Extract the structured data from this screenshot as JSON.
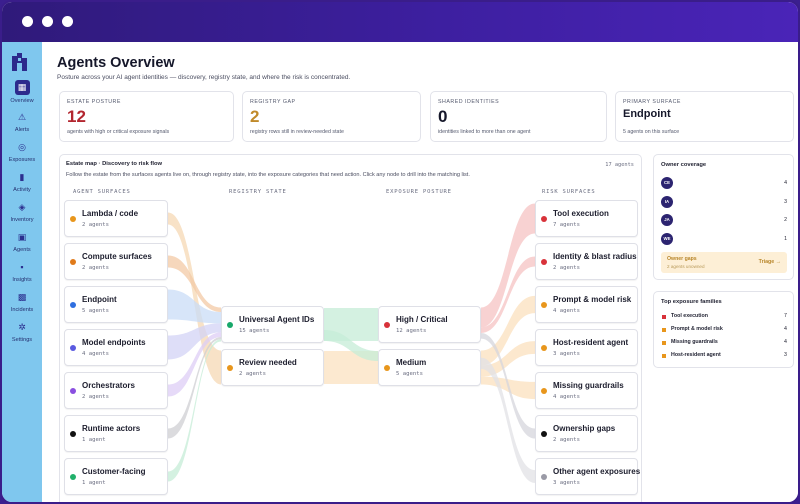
{
  "window": {
    "controls": [
      "close",
      "minimize",
      "maximize"
    ]
  },
  "sidebar": {
    "logo": "brand-logo",
    "items": [
      {
        "id": "overview",
        "label": "Overview",
        "icon": "grid-icon",
        "active": true
      },
      {
        "id": "alerts",
        "label": "Alerts",
        "icon": "warning-triangle-icon"
      },
      {
        "id": "exposures",
        "label": "Exposures",
        "icon": "target-icon"
      },
      {
        "id": "activity",
        "label": "Activity",
        "icon": "bar-chart-icon"
      },
      {
        "id": "inventory",
        "label": "Inventory",
        "icon": "layers-icon"
      },
      {
        "id": "agents",
        "label": "Agents",
        "icon": "robot-icon"
      },
      {
        "id": "insights",
        "label": "Insights",
        "icon": "lightbulb-icon"
      },
      {
        "id": "incidents",
        "label": "Incidents",
        "icon": "incident-grid-icon"
      },
      {
        "id": "settings",
        "label": "Settings",
        "icon": "gear-icon"
      }
    ]
  },
  "page": {
    "title": "Agents Overview",
    "subtitle": "Posture across your AI agent identities — discovery, registry state, and where the risk is concentrated."
  },
  "kpis": [
    {
      "label": "ESTATE POSTURE",
      "value": "12",
      "note": "agents with high or critical exposure signals",
      "color": "#b3262f"
    },
    {
      "label": "REGISTRY GAP",
      "value": "2",
      "note": "registry rows still in review-needed state",
      "color": "#c08a2a"
    },
    {
      "label": "SHARED IDENTITIES",
      "value": "0",
      "note": "identities linked to more than one agent",
      "color": "#15172a"
    },
    {
      "label": "PRIMARY SURFACE",
      "value": "Endpoint",
      "note": "5 agents on this surface",
      "color": "#15172a"
    }
  ],
  "estate_map": {
    "title": "Estate map · Discovery to risk flow",
    "count": "17 agents",
    "description": "Follow the estate from the surfaces agents live on, through registry state, into the exposure categories that need action. Click any node to drill into the matching list.",
    "columns": [
      "AGENT SURFACES",
      "REGISTRY STATE",
      "EXPOSURE POSTURE",
      "RISK SURFACES"
    ],
    "surfaces": [
      {
        "name": "Lambda / code",
        "sub": "2 agents",
        "count": 2,
        "color": "#e8961c"
      },
      {
        "name": "Compute surfaces",
        "sub": "2 agents",
        "count": 2,
        "color": "#e07a1a"
      },
      {
        "name": "Endpoint",
        "sub": "5 agents",
        "count": 5,
        "color": "#2f6fe0"
      },
      {
        "name": "Model endpoints",
        "sub": "4 agents",
        "count": 4,
        "color": "#5a5ae0"
      },
      {
        "name": "Orchestrators",
        "sub": "2 agents",
        "count": 2,
        "color": "#8a4fe0"
      },
      {
        "name": "Runtime actors",
        "sub": "1 agent",
        "count": 1,
        "color": "#111111"
      },
      {
        "name": "Customer-facing",
        "sub": "1 agent",
        "count": 1,
        "color": "#20b06a"
      }
    ],
    "registry": [
      {
        "name": "Universal Agent IDs",
        "sub": "15 agents",
        "count": 15,
        "color": "#18a86a"
      },
      {
        "name": "Review needed",
        "sub": "2 agents",
        "count": 2,
        "color": "#e8961c"
      }
    ],
    "exposure": [
      {
        "name": "High / Critical",
        "sub": "12 agents",
        "count": 12,
        "color": "#d8323a"
      },
      {
        "name": "Medium",
        "sub": "5 agents",
        "count": 5,
        "color": "#e8961c"
      }
    ],
    "risks": [
      {
        "name": "Tool execution",
        "sub": "7 agents",
        "count": 7,
        "color": "#d8323a"
      },
      {
        "name": "Identity & blast radius",
        "sub": "2 agents",
        "count": 2,
        "color": "#d8323a"
      },
      {
        "name": "Prompt & model risk",
        "sub": "4 agents",
        "count": 4,
        "color": "#e8961c"
      },
      {
        "name": "Host-resident agent",
        "sub": "3 agents",
        "count": 3,
        "color": "#e8961c"
      },
      {
        "name": "Missing guardrails",
        "sub": "4 agents",
        "count": 4,
        "color": "#e8961c"
      },
      {
        "name": "Ownership gaps",
        "sub": "2 agents",
        "count": 2,
        "color": "#111111"
      },
      {
        "name": "Other agent exposures",
        "sub": "3 agents",
        "count": 3,
        "color": "#9a9aa6"
      }
    ],
    "link_colors": {
      "surface": [
        "#f6d8b4",
        "#f3c9a6",
        "#c9dcf7",
        "#d3d3f6",
        "#ddcdf6",
        "#cfcfd3",
        "#c6ecd7"
      ],
      "middle": [
        "#c6ecd7",
        "#fbe2c0"
      ],
      "risk": [
        "#f6c3c3",
        "#f6c3c3",
        "#fbe0bd",
        "#fbe0bd",
        "#fbe0bd",
        "#d6d6dc",
        "#e2e2e6"
      ]
    }
  },
  "owner_coverage": {
    "title": "Owner coverage",
    "owners": [
      {
        "initials": "CE",
        "count": "4"
      },
      {
        "initials": "IA",
        "count": "3"
      },
      {
        "initials": "JA",
        "count": "2"
      },
      {
        "initials": "WE",
        "count": "1"
      }
    ],
    "gaps": {
      "title": "Owner gaps",
      "note": "2 agents unowned",
      "action": "Triage →"
    }
  },
  "top_families": {
    "title": "Top exposure families",
    "items": [
      {
        "name": "Tool execution",
        "count": "7",
        "color": "#d8323a"
      },
      {
        "name": "Prompt & model risk",
        "count": "4",
        "color": "#e8961c"
      },
      {
        "name": "Missing guardrails",
        "count": "4",
        "color": "#e8961c"
      },
      {
        "name": "Host-resident agent",
        "count": "3",
        "color": "#e8961c"
      }
    ]
  }
}
